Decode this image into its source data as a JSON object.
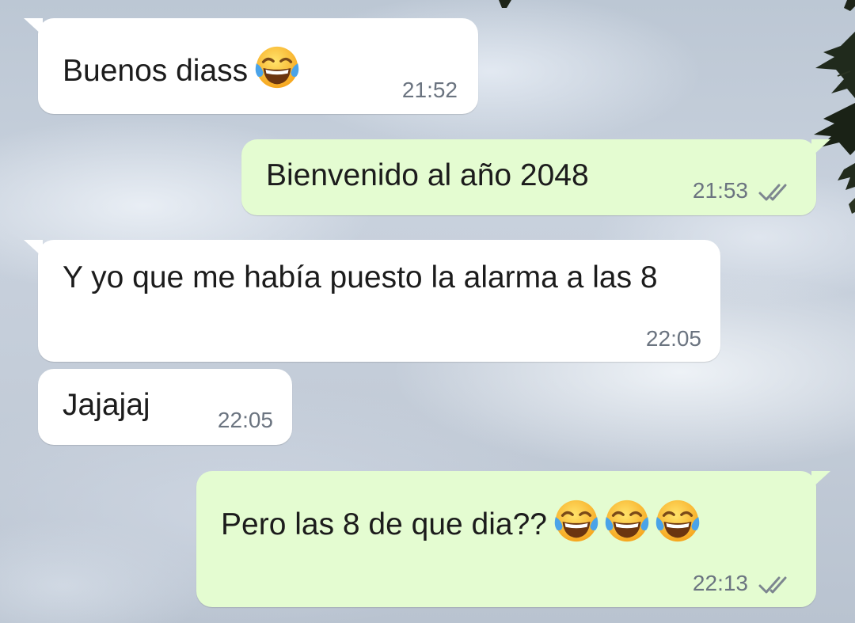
{
  "chat": {
    "messages": [
      {
        "direction": "incoming",
        "text": "Buenos diass",
        "emoji_count": 1,
        "emoji": "face-with-tears-of-joy",
        "time": "21:52"
      },
      {
        "direction": "outgoing",
        "text": "Bienvenido al año 2048",
        "emoji_count": 0,
        "time": "21:53",
        "status": "read"
      },
      {
        "direction": "incoming",
        "text": "Y yo que me había puesto la alarma a las 8",
        "emoji_count": 0,
        "time": "22:05"
      },
      {
        "direction": "incoming",
        "text": "Jajajaj",
        "emoji_count": 0,
        "time": "22:05"
      },
      {
        "direction": "outgoing",
        "text": "Pero las 8 de que dia??",
        "emoji_count": 3,
        "emoji": "face-with-tears-of-joy",
        "time": "22:13",
        "status": "read"
      }
    ]
  },
  "colors": {
    "incoming_bubble": "#ffffff",
    "outgoing_bubble": "#e4fcd1",
    "timestamp": "#6b7480",
    "read_ticks": "#7d8690"
  }
}
